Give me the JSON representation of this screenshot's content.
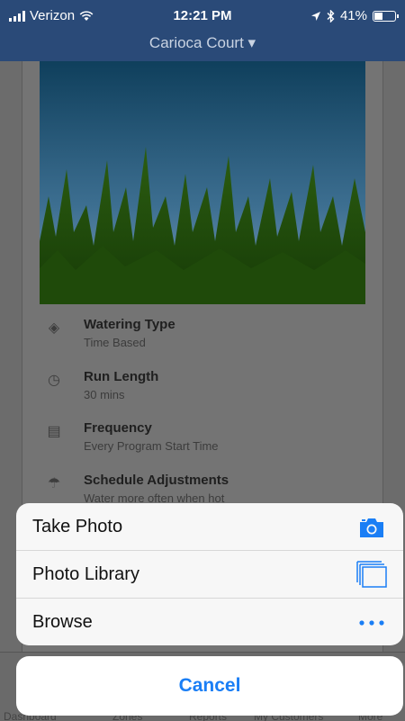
{
  "status_bar": {
    "carrier": "Verizon",
    "time": "12:21 PM",
    "battery": "41%",
    "battery_level": 0.41
  },
  "nav": {
    "title": "Carioca Court"
  },
  "details": [
    {
      "icon": "tag-icon",
      "title": "Watering Type",
      "value": "Time Based"
    },
    {
      "icon": "clock-icon",
      "title": "Run Length",
      "value": "30 mins"
    },
    {
      "icon": "calendar-list-icon",
      "title": "Frequency",
      "value": "Every Program Start Time"
    },
    {
      "icon": "umbrella-icon",
      "title": "Schedule Adjustments",
      "value": "Water more often when hot"
    }
  ],
  "tabbar": {
    "items": [
      "Dashboard",
      "Zones",
      "Reports",
      "My Customers",
      "More"
    ]
  },
  "action_sheet": {
    "actions": [
      {
        "label": "Take Photo",
        "icon": "camera-icon"
      },
      {
        "label": "Photo Library",
        "icon": "photo-library-icon"
      },
      {
        "label": "Browse",
        "icon": "more-dots-icon"
      }
    ],
    "cancel_label": "Cancel"
  },
  "colors": {
    "header": "#2a4a78",
    "accent": "#1a7ef5"
  }
}
